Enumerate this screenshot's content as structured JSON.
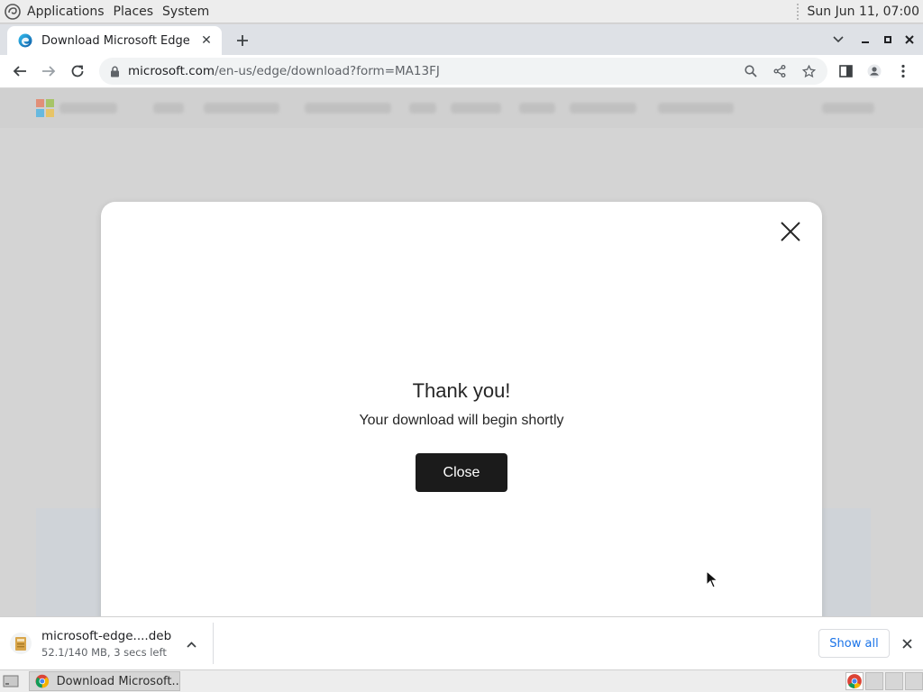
{
  "top_panel": {
    "menus": [
      "Applications",
      "Places",
      "System"
    ],
    "clock": "Sun Jun 11, 07:00"
  },
  "browser": {
    "tab": {
      "title": "Download Microsoft Edge",
      "favicon": "edge-icon"
    },
    "url": {
      "domain": "microsoft.com",
      "path": "/en-us/edge/download?form=MA13FJ"
    }
  },
  "modal": {
    "heading": "Thank you!",
    "subtext": "Your download will begin shortly",
    "button_label": "Close"
  },
  "download_shelf": {
    "file_name": "microsoft-edge....deb",
    "status": "52.1/140 MB, 3 secs left",
    "show_all_label": "Show all"
  },
  "taskbar": {
    "window_label": "Download Microsoft..."
  },
  "colors": {
    "modal_button": "#1b1b1b",
    "show_all_text": "#1a73e8",
    "page_overlay": "#d4d4d4"
  }
}
